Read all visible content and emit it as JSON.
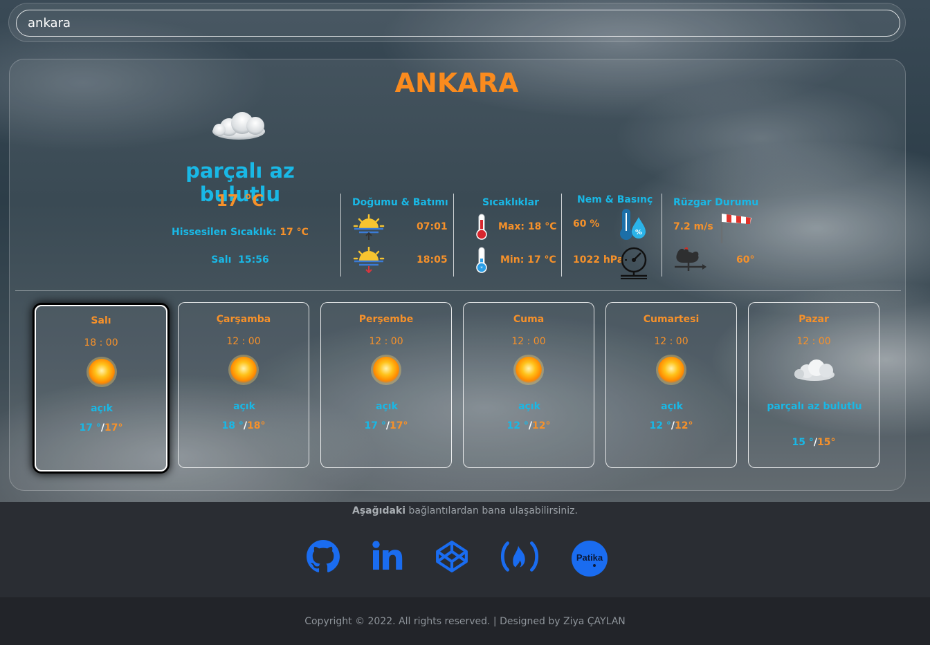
{
  "search": {
    "value": "ankara"
  },
  "current": {
    "city": "ANKARA",
    "description": "parçalı az bulutlu",
    "temperature": "17 °C",
    "feels_label": "Hissesilen Sıcaklık:",
    "feels_value": "17 °C",
    "day_time": "Salı  15:56",
    "icon": "cloud-icon"
  },
  "sun": {
    "title": "Doğumu & Batımı",
    "sunrise": "07:01",
    "sunset": "18:05"
  },
  "temps": {
    "title": "Sıcaklıklar",
    "max": "Max: 18 °C",
    "min": "Min: 17 °C"
  },
  "humidity": {
    "title": "Nem & Basınç",
    "humidity": "60 %",
    "pressure": "1022 hPa"
  },
  "wind": {
    "title": "Rüzgar Durumu",
    "speed": "7.2 m/s",
    "direction": "60°"
  },
  "forecast": [
    {
      "day": "Salı",
      "hour": "18 : 00",
      "icon": "sun-icon",
      "desc": "açık",
      "lo": "17 °",
      "hi": "17°",
      "active": true
    },
    {
      "day": "Çarşamba",
      "hour": "12 : 00",
      "icon": "sun-icon",
      "desc": "açık",
      "lo": "18 °",
      "hi": "18°"
    },
    {
      "day": "Perşembe",
      "hour": "12 : 00",
      "icon": "sun-icon",
      "desc": "açık",
      "lo": "17 °",
      "hi": "17°"
    },
    {
      "day": "Cuma",
      "hour": "12 : 00",
      "icon": "sun-icon",
      "desc": "açık",
      "lo": "12 °",
      "hi": "12°"
    },
    {
      "day": "Cumartesi",
      "hour": "12 : 00",
      "icon": "sun-icon",
      "desc": "açık",
      "lo": "12 °",
      "hi": "12°"
    },
    {
      "day": "Pazar",
      "hour": "12 : 00",
      "icon": "cloud-icon",
      "desc": "parçalı az bulutlu",
      "lo": "15 °",
      "hi": "15°"
    }
  ],
  "forecast_separator": "/",
  "footer": {
    "contact_bold": "Aşağıdaki",
    "contact_rest": " bağlantılardan bana ulaşabilirsiniz.",
    "social": [
      "github-icon",
      "linkedin-icon",
      "codepen-icon",
      "freecodecamp-icon",
      "patika-icon"
    ],
    "patika_label": "Patika",
    "copyright": "Copyright © 2022. All rights reserved. | Designed by Ziya ÇAYLAN"
  },
  "colors": {
    "orange": "#fa8b1e",
    "blue": "#19b8e6",
    "social": "#1a6cf0"
  }
}
